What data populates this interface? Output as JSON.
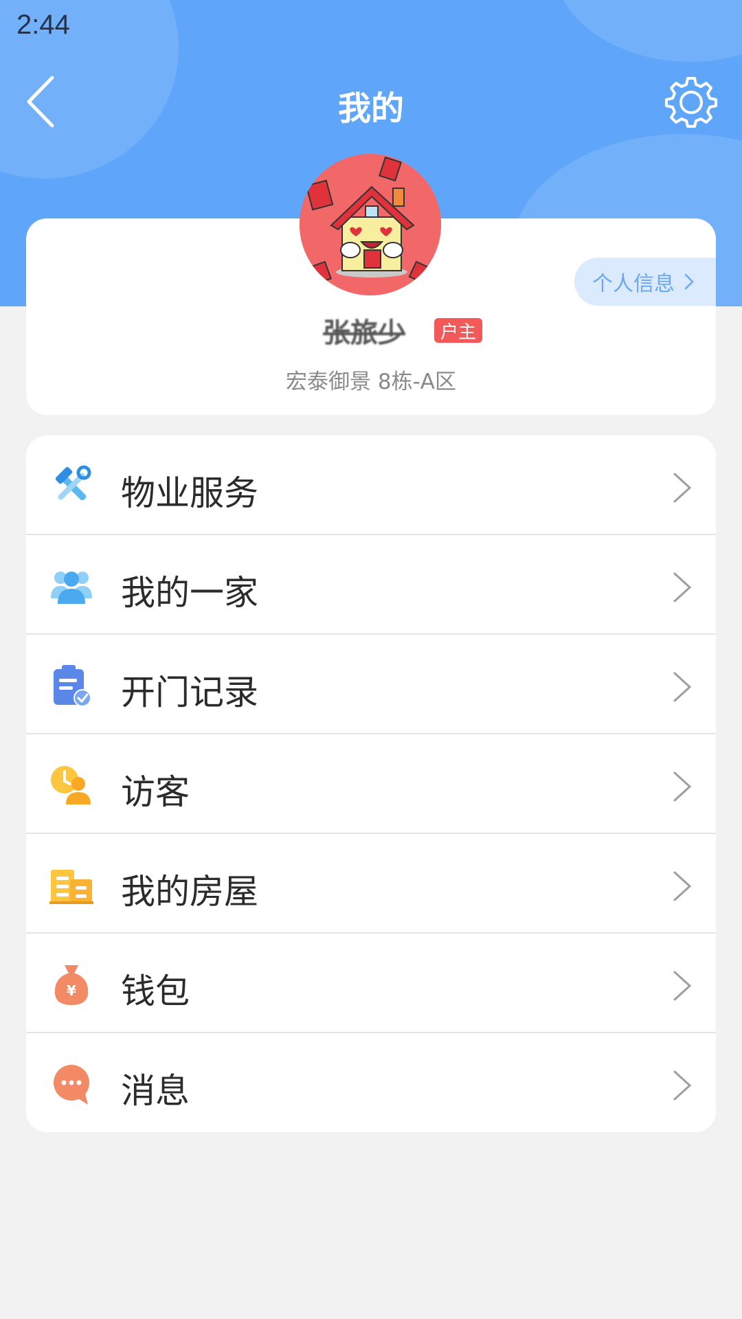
{
  "status_bar": {
    "time": "2:44"
  },
  "header": {
    "title": "我的"
  },
  "profile": {
    "name": "张旅少",
    "badge": "户主",
    "address": "宏泰御景 8栋-A区",
    "info_button": "个人信息"
  },
  "menu": [
    {
      "label": "物业服务",
      "icon": "tools-icon"
    },
    {
      "label": "我的一家",
      "icon": "family-icon"
    },
    {
      "label": "开门记录",
      "icon": "door-record-icon"
    },
    {
      "label": "访客",
      "icon": "visitor-icon"
    },
    {
      "label": "我的房屋",
      "icon": "house-icon"
    },
    {
      "label": "钱包",
      "icon": "wallet-icon"
    },
    {
      "label": "消息",
      "icon": "message-icon"
    }
  ],
  "colors": {
    "header_bg": "#5fa6fa",
    "page_bg": "#f2f2f2",
    "badge_red": "#f25a5a",
    "avatar_bg": "#f26767",
    "info_button_bg": "#dbeafd",
    "info_button_text": "#6aa8f5"
  }
}
